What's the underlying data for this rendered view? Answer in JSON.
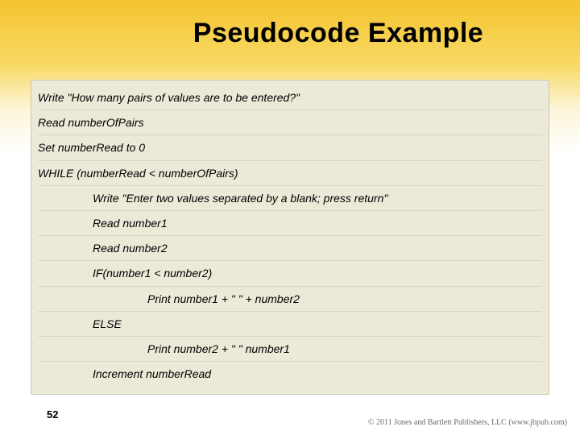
{
  "title": "Pseudocode Example",
  "lines": [
    {
      "text": "Write \"How many pairs of values are to be entered?\"",
      "indent": 0
    },
    {
      "text": "Read numberOfPairs",
      "indent": 0
    },
    {
      "text": "Set numberRead to 0",
      "indent": 0
    },
    {
      "text": "WHILE (numberRead < numberOfPairs)",
      "indent": 0
    },
    {
      "text": "Write \"Enter two values separated by a blank; press return\"",
      "indent": 1
    },
    {
      "text": "Read number1",
      "indent": 1
    },
    {
      "text": "Read number2",
      "indent": 1
    },
    {
      "text": "IF(number1 < number2)",
      "indent": 1
    },
    {
      "text": "Print number1 + \" \" + number2",
      "indent": 2
    },
    {
      "text": "ELSE",
      "indent": 1
    },
    {
      "text": "Print number2 + \" \" number1",
      "indent": 2
    },
    {
      "text": "Increment numberRead",
      "indent": 1
    }
  ],
  "pageNumber": "52",
  "copyright": "© 2011 Jones and Bartlett Publishers, LLC (www.jbpub.com)"
}
